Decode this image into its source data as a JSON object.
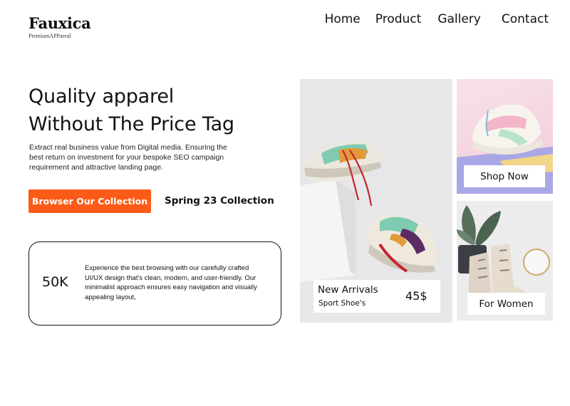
{
  "brand": {
    "name": "Fauxica",
    "tagline": "PremiumAPPareal"
  },
  "nav": {
    "items": [
      "Home",
      "Product",
      "Gallery",
      "Contact"
    ]
  },
  "hero": {
    "title_line1": "Quality apparel",
    "title_line2": "Without The Price Tag",
    "description": "Extract real business value from Digital media. Ensuring the best return on investment for your bespoke SEO campaign requirement and attractive landing page.",
    "cta_label": "Browser Our Collection",
    "season_label": "Spring 23 Collection",
    "cta_color": "#fb5b17"
  },
  "stat": {
    "value": "50K",
    "text": "Experience the best browsing with our carefully crafted UI/UX design that's clean, modern, and user-friendly. Our minimalist approach ensures easy navigation and visually appealing layout,"
  },
  "products": {
    "new_arrivals": {
      "title": "New Arrivals",
      "subtitle": "Sport Shoe's",
      "price": "45$"
    },
    "shop_now_label": "Shop Now",
    "for_women_label": "For Women"
  }
}
